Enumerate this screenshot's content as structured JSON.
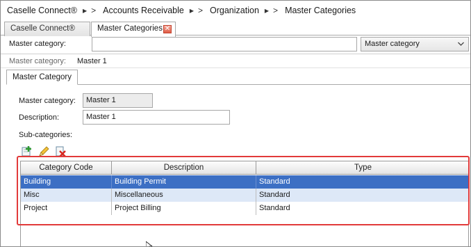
{
  "breadcrumb": {
    "items": [
      "Caselle Connect®",
      "Accounts Receivable",
      "Organization",
      "Master Categories"
    ]
  },
  "tabs": [
    {
      "label": "Caselle Connect®"
    },
    {
      "label": "Master Categories"
    }
  ],
  "search": {
    "label": "Master category:",
    "value": "",
    "select_value": "Master category"
  },
  "record_header": {
    "label": "Master category:",
    "value": "Master 1"
  },
  "inner_tab": {
    "label": "Master Category"
  },
  "form": {
    "master_label": "Master category:",
    "master_value": "Master 1",
    "description_label": "Description:",
    "description_value": "Master 1",
    "subcategories_label": "Sub-categories:"
  },
  "grid": {
    "columns": [
      "Category Code",
      "Description",
      "Type"
    ],
    "rows": [
      {
        "code": "Building",
        "description": "Building Permit",
        "type": "Standard"
      },
      {
        "code": "Misc",
        "description": "Miscellaneous",
        "type": "Standard"
      },
      {
        "code": "Project",
        "description": "Project Billing",
        "type": "Standard"
      }
    ]
  },
  "colors": {
    "selection": "#3c6fc4",
    "alt_row": "#dde8f7",
    "highlight_border": "#e23a3a",
    "close_tab": "#e05c45"
  },
  "icons": [
    "chevron-right-icon",
    "close-icon",
    "chevron-down-icon",
    "add-icon",
    "edit-pencil-icon",
    "delete-icon",
    "mouse-cursor-icon"
  ]
}
